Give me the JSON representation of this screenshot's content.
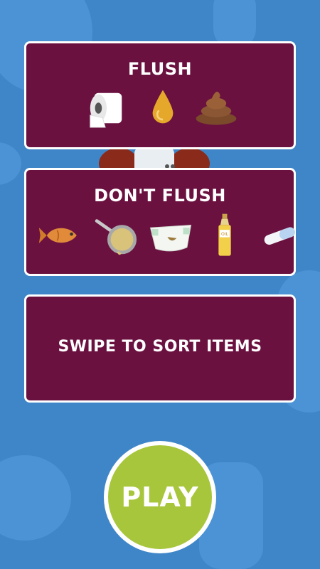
{
  "flush_card": {
    "title": "FLUSH",
    "items": [
      "toilet-paper",
      "urine-drop",
      "poop"
    ]
  },
  "dont_flush_card": {
    "title": "DON'T FLUSH",
    "items": [
      "fish",
      "frying-pan-with-grease",
      "diaper",
      "oil-bottle",
      "pill-capsule"
    ],
    "oil_label": "OIL"
  },
  "instruction_card": {
    "text": "SWIPE TO SORT ITEMS"
  },
  "play_button": {
    "label": "PLAY"
  },
  "colors": {
    "background": "#3f86c8",
    "card": "#6a1140",
    "play": "#a8c63b"
  }
}
